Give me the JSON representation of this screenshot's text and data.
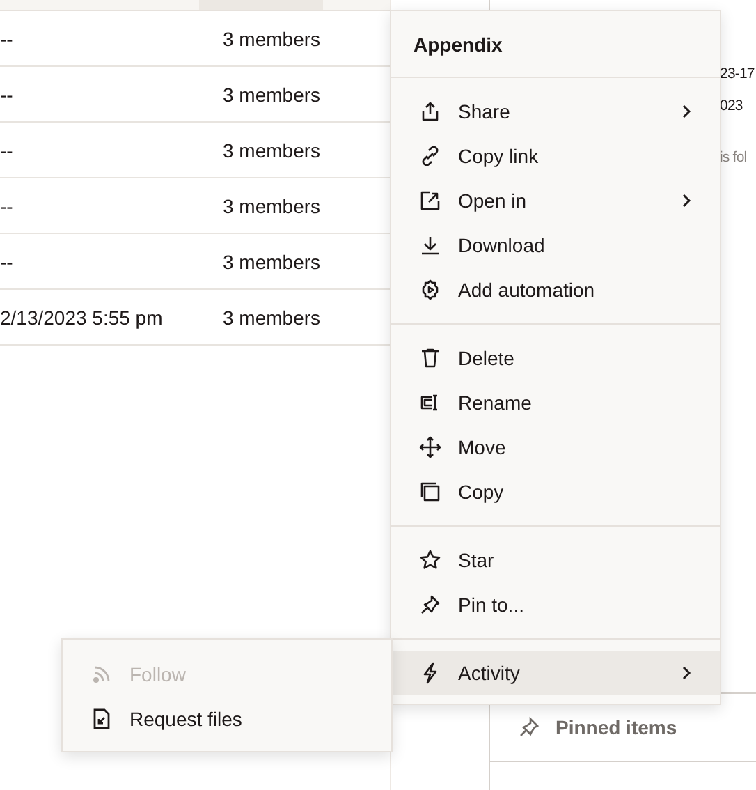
{
  "table": {
    "rows": [
      {
        "modified": "--",
        "members": "3 members"
      },
      {
        "modified": "--",
        "members": "3 members"
      },
      {
        "modified": "--",
        "members": "3 members"
      },
      {
        "modified": "--",
        "members": "3 members"
      },
      {
        "modified": "--",
        "members": "3 members"
      },
      {
        "modified": "2/13/2023 5:55 pm",
        "members": "3 members"
      }
    ]
  },
  "side_panel": {
    "lines": [
      {
        "text": "23-17",
        "muted": false
      },
      {
        "text": "023",
        "muted": false
      },
      {
        "text": "is fol",
        "muted": true
      }
    ],
    "pinned": {
      "label": "Pinned items"
    }
  },
  "context_menu": {
    "title": "Appendix",
    "groups": [
      [
        {
          "kind": "share",
          "label": "Share",
          "submenu": true,
          "selected": false
        },
        {
          "kind": "link",
          "label": "Copy link",
          "submenu": false,
          "selected": false
        },
        {
          "kind": "open",
          "label": "Open in",
          "submenu": true,
          "selected": false
        },
        {
          "kind": "download",
          "label": "Download",
          "submenu": false,
          "selected": false
        },
        {
          "kind": "automation",
          "label": "Add automation",
          "submenu": false,
          "selected": false
        }
      ],
      [
        {
          "kind": "delete",
          "label": "Delete",
          "submenu": false,
          "selected": false
        },
        {
          "kind": "rename",
          "label": "Rename",
          "submenu": false,
          "selected": false
        },
        {
          "kind": "move",
          "label": "Move",
          "submenu": false,
          "selected": false
        },
        {
          "kind": "copy",
          "label": "Copy",
          "submenu": false,
          "selected": false
        }
      ],
      [
        {
          "kind": "star",
          "label": "Star",
          "submenu": false,
          "selected": false
        },
        {
          "kind": "pin",
          "label": "Pin to...",
          "submenu": false,
          "selected": false
        }
      ],
      [
        {
          "kind": "activity",
          "label": "Activity",
          "submenu": true,
          "selected": true
        }
      ]
    ]
  },
  "submenu": {
    "items": [
      {
        "kind": "follow",
        "label": "Follow",
        "disabled": true
      },
      {
        "kind": "request",
        "label": "Request files",
        "disabled": false
      }
    ]
  }
}
